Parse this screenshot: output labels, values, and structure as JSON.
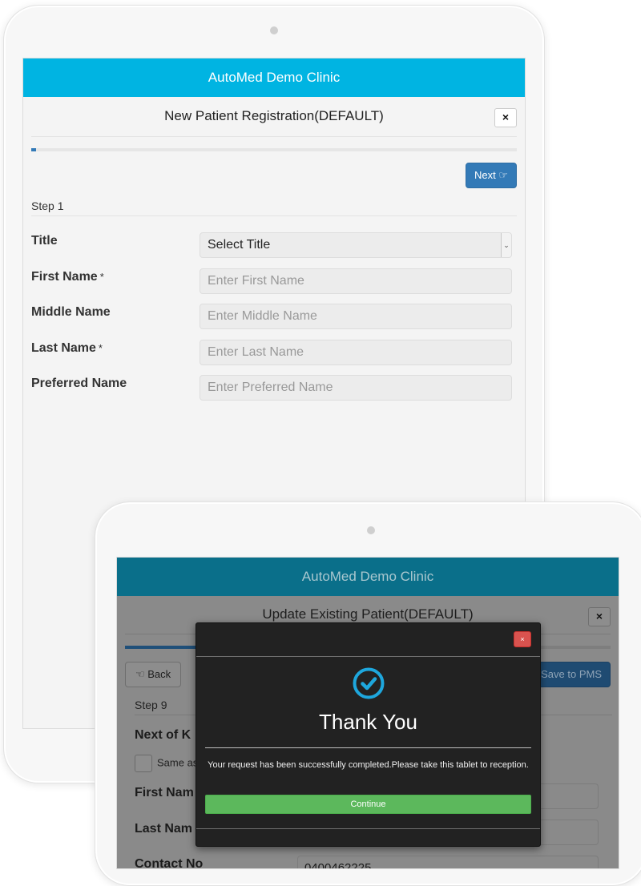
{
  "screen1": {
    "header_title": "AutoMed Demo Clinic",
    "form_title": "New Patient Registration(DEFAULT)",
    "close_icon": "×",
    "progress_fraction": 0.01,
    "next_label": "Next ☞",
    "step_label": "Step 1",
    "required_mark": "*",
    "fields": {
      "title": {
        "label": "Title",
        "value": "Select Title"
      },
      "first_name": {
        "label": "First Name",
        "placeholder": "Enter First Name"
      },
      "middle_name": {
        "label": "Middle Name",
        "placeholder": "Enter Middle Name"
      },
      "last_name": {
        "label": "Last Name",
        "placeholder": "Enter Last Name"
      },
      "preferred_name": {
        "label": "Preferred Name",
        "placeholder": "Enter Preferred Name"
      }
    }
  },
  "screen2": {
    "header_title": "AutoMed Demo Clinic",
    "form_title": "Update Existing Patient(DEFAULT)",
    "close_icon": "×",
    "back_label": "☜ Back",
    "save_label": "Save to PMS",
    "step_label": "Step 9",
    "section_heading": "Next of K",
    "same_as_label": "Same as",
    "first_name_label": "First Nam",
    "last_name_label": "Last Nam",
    "contact_label": "Contact No",
    "contact_value": "0400462225"
  },
  "modal": {
    "close_icon": "×",
    "icon": "check-circle-icon",
    "title": "Thank You",
    "message": "Your request has been successfully completed.Please take this tablet to reception.",
    "continue_label": "Continue"
  },
  "colors": {
    "header_blue": "#00b4e2",
    "primary": "#337ab7",
    "success": "#5cb85c",
    "danger": "#d9534f",
    "modal_bg": "#222222"
  }
}
